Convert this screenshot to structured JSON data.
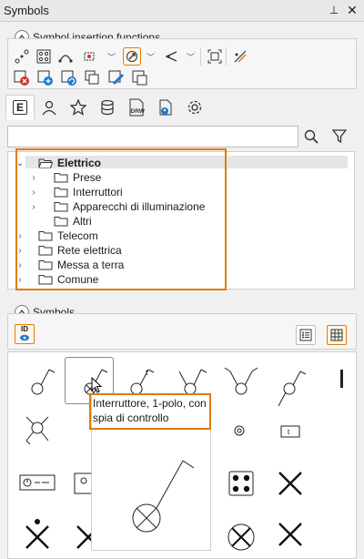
{
  "panel": {
    "title": "Symbols",
    "pin_glyph": "⬍",
    "close_glyph": "✕"
  },
  "insertion": {
    "header": "Symbol insertion functions",
    "tools_row1": [
      "connect-points-icon",
      "grid-symbol-icon",
      "arc-connect-icon",
      "multi-connect-icon",
      "rotate-connect-icon",
      "direction-connect-icon",
      "fit-frame-icon",
      "route-wire-icon"
    ],
    "tools_row2": [
      "delete-symbol-icon",
      "add-symbol-icon",
      "replace-symbol-icon",
      "copy-symbol-icon",
      "edit-symbol-icon",
      "move-symbol-icon"
    ]
  },
  "tabs": [
    "E",
    "user-icon",
    "star-icon",
    "database-icon",
    "DRW",
    "user-file-icon",
    "gear-icon"
  ],
  "search": {
    "value": "",
    "placeholder": ""
  },
  "tree": {
    "items": [
      {
        "label": "Elettrico",
        "level": 0,
        "expanded": true,
        "bold": true
      },
      {
        "label": "Prese",
        "level": 1
      },
      {
        "label": "Interruttori",
        "level": 1
      },
      {
        "label": "Apparecchi di illuminazione",
        "level": 1
      },
      {
        "label": "Altri",
        "level": 1
      },
      {
        "label": "Telecom",
        "level": 0
      },
      {
        "label": "Rete elettrica",
        "level": 0
      },
      {
        "label": "Messa a terra",
        "level": 0
      },
      {
        "label": "Comune",
        "level": 0
      }
    ]
  },
  "symbols_section": {
    "header": "Symbols",
    "id_button": "ID"
  },
  "tooltip": {
    "text": "Interruttore, 1-polo, con spia di controllo"
  },
  "symbol_t_labels": [
    "t",
    "t"
  ],
  "accent_color": "#e07b0a"
}
